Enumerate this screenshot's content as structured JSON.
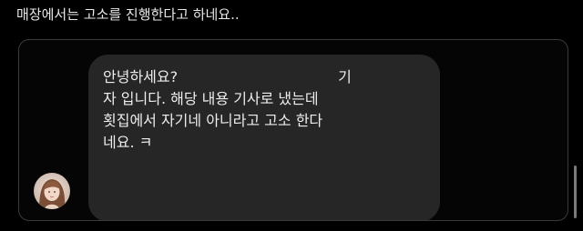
{
  "post": {
    "caption": "매장에서는 고소를 진행한다고 하네요.."
  },
  "message": {
    "line1_text": "안녕하세요?",
    "line1_tail": "기",
    "line2": "자 입니다. 해당 내용 기사로 냈는데",
    "line3": "횟집에서 자기네 아니라고 고소 한다",
    "line4": "네요. ㅋ"
  },
  "avatar": {
    "icon": "profile-photo-icon"
  },
  "colors": {
    "background": "#000000",
    "bubble": "#262626",
    "text": "#ededed",
    "frame_border": "#3a3a3a"
  }
}
